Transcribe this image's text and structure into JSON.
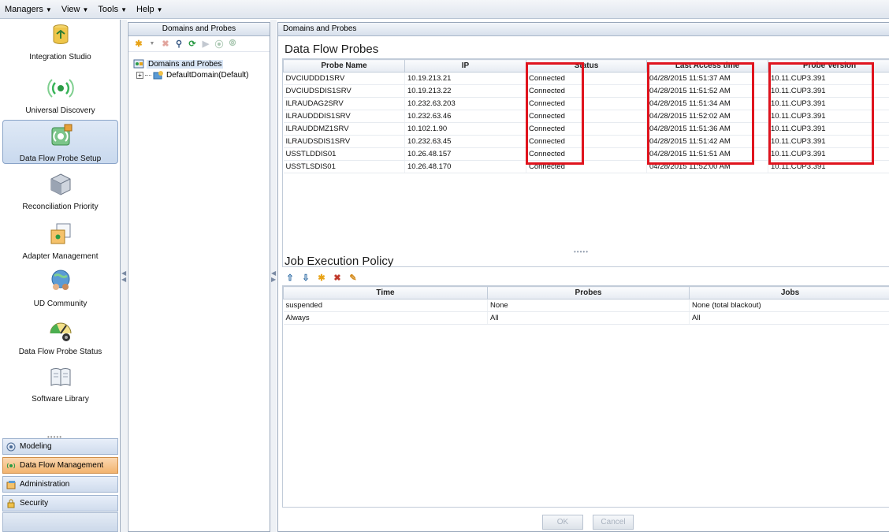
{
  "menubar": {
    "items": [
      {
        "label": "Managers"
      },
      {
        "label": "View"
      },
      {
        "label": "Tools"
      },
      {
        "label": "Help"
      }
    ]
  },
  "nav": {
    "apps": [
      {
        "label": "Integration Studio",
        "icon": "database-icon"
      },
      {
        "label": "Universal Discovery",
        "icon": "signal-icon"
      },
      {
        "label": "Data Flow Probe Setup",
        "icon": "probe-setup-icon",
        "selected": true
      },
      {
        "label": "Reconciliation Priority",
        "icon": "cube-icon"
      },
      {
        "label": "Adapter Management",
        "icon": "adapter-icon"
      },
      {
        "label": "UD Community",
        "icon": "community-icon"
      },
      {
        "label": "Data Flow Probe Status",
        "icon": "gauge-icon"
      },
      {
        "label": "Software Library",
        "icon": "library-icon"
      }
    ],
    "modules": [
      {
        "label": "Modeling",
        "icon": "modeling-icon"
      },
      {
        "label": "Data Flow Management",
        "icon": "dataflow-icon",
        "active": true
      },
      {
        "label": "Administration",
        "icon": "admin-icon"
      },
      {
        "label": "Security",
        "icon": "lock-icon"
      }
    ]
  },
  "tree": {
    "header": "Domains and Probes",
    "root": "Domains and Probes",
    "child": "DefaultDomain(Default)"
  },
  "main": {
    "header": "Domains and Probes",
    "probes_title": "Data Flow Probes",
    "probe_columns": [
      "Probe Name",
      "IP",
      "Status",
      "Last Access time",
      "Probe Version"
    ],
    "probes": [
      [
        "DVCIUDDD1SRV",
        "10.19.213.21",
        "Connected",
        "04/28/2015 11:51:37 AM",
        "10.11.CUP3.391"
      ],
      [
        "DVCIUDSDIS1SRV",
        "10.19.213.22",
        "Connected",
        "04/28/2015 11:51:52 AM",
        "10.11.CUP3.391"
      ],
      [
        "ILRAUDAG2SRV",
        "10.232.63.203",
        "Connected",
        "04/28/2015 11:51:34 AM",
        "10.11.CUP3.391"
      ],
      [
        "ILRAUDDDIS1SRV",
        "10.232.63.46",
        "Connected",
        "04/28/2015 11:52:02 AM",
        "10.11.CUP3.391"
      ],
      [
        "ILRAUDDMZ1SRV",
        "10.102.1.90",
        "Connected",
        "04/28/2015 11:51:36 AM",
        "10.11.CUP3.391"
      ],
      [
        "ILRAUDSDIS1SRV",
        "10.232.63.45",
        "Connected",
        "04/28/2015 11:51:42 AM",
        "10.11.CUP3.391"
      ],
      [
        "USSTLDDIS01",
        "10.26.48.157",
        "Connected",
        "04/28/2015 11:51:51 AM",
        "10.11.CUP3.391"
      ],
      [
        "USSTLSDIS01",
        "10.26.48.170",
        "Connected",
        "04/28/2015 11:52:00 AM",
        "10.11.CUP3.391"
      ]
    ],
    "job_title": "Job Execution Policy",
    "job_columns": [
      "Time",
      "Probes",
      "Jobs"
    ],
    "jobs": [
      [
        "suspended",
        "None",
        "None (total blackout)"
      ],
      [
        "Always",
        "All",
        "All"
      ]
    ],
    "ok_label": "OK",
    "cancel_label": "Cancel"
  },
  "colors": {
    "highlight": "#e0141e",
    "active_module": "#f2b36f",
    "selected_app": "#c9d9ee"
  }
}
